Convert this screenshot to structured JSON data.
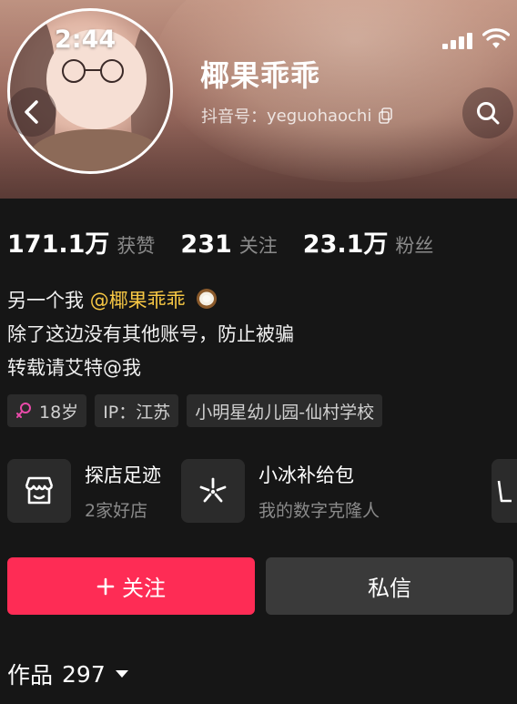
{
  "status_bar": {
    "time": "2:44"
  },
  "profile": {
    "name": "椰果乖乖",
    "douyin_id_label": "抖音号：",
    "douyin_id": "yeguohaochi"
  },
  "stats": [
    {
      "value": "171.1万",
      "label": "获赞"
    },
    {
      "value": "231",
      "label": "关注"
    },
    {
      "value": "23.1万",
      "label": "粉丝"
    }
  ],
  "bio": {
    "line1_prefix": "另一个我 ",
    "line1_mention": "@椰果乖乖",
    "line2": "除了这边没有其他账号，防止被骗",
    "line3": "转载请艾特@我"
  },
  "tags": [
    {
      "text": "18岁",
      "icon": "female-icon"
    },
    {
      "text": "IP：江苏"
    },
    {
      "text": "小明星幼儿园-仙村学校"
    }
  ],
  "cards": [
    {
      "title": "探店足迹",
      "subtitle": "2家好店",
      "icon": "shop-icon"
    },
    {
      "title": "小冰补给包",
      "subtitle": "我的数字克隆人",
      "icon": "sparkle-icon"
    }
  ],
  "actions": {
    "follow": "关注",
    "message": "私信"
  },
  "works": {
    "label": "作品",
    "count": "297"
  },
  "colors": {
    "accent": "#fe2c55",
    "mention": "#f6c744",
    "background": "#161616"
  }
}
